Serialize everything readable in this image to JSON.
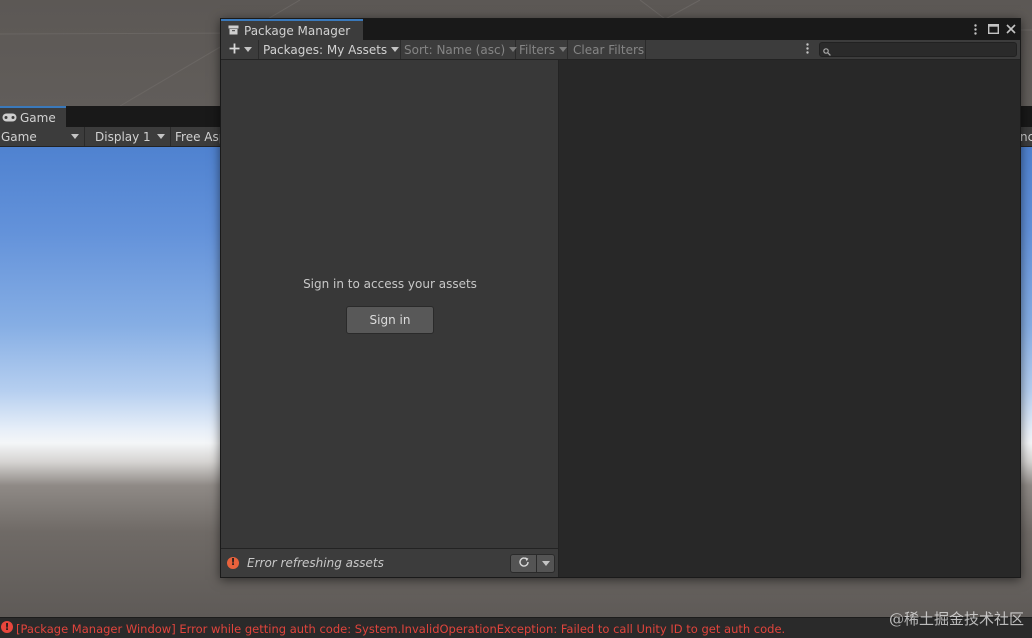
{
  "game": {
    "tab_label": "Game",
    "toolbar": {
      "mode_label": "Game",
      "display_label": "Display 1",
      "aspect_label": "Free Asp",
      "right_partial": "nc"
    }
  },
  "package_manager": {
    "title": "Package Manager",
    "toolbar": {
      "add_label": "+",
      "packages_label": "Packages: My Assets",
      "sort_label": "Sort: Name (asc)",
      "filters_label": "Filters",
      "clear_filters_label": "Clear Filters",
      "search_placeholder": ""
    },
    "left": {
      "signin_message": "Sign in to access your assets",
      "signin_button": "Sign in"
    },
    "footer": {
      "error_text": "Error refreshing assets"
    }
  },
  "status_bar": {
    "message": "[Package Manager Window] Error while getting auth code: System.InvalidOperationException: Failed to call Unity ID to get auth code."
  },
  "watermark": "@稀土掘金技术社区",
  "colors": {
    "accent_tab": "#3a79bb",
    "error_red": "#e0443c",
    "warning_orange": "#e8623c"
  }
}
